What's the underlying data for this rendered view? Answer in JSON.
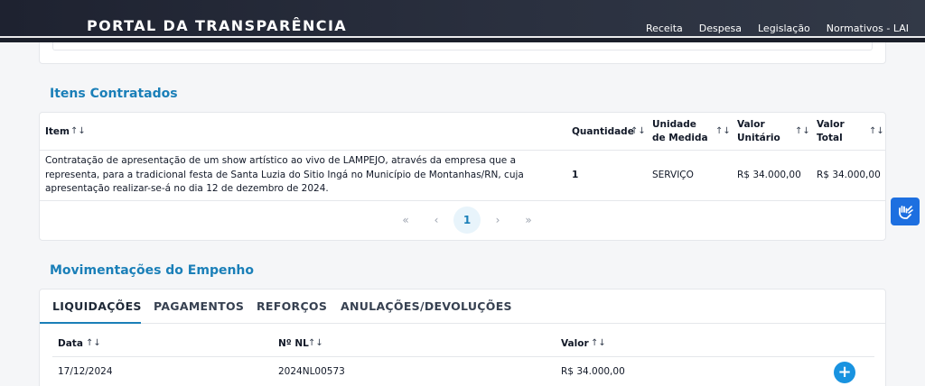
{
  "header": {
    "brand": "PORTAL DA TRANSPARÊNCIA",
    "nav": [
      "Receita",
      "Despesa",
      "Legislação",
      "Normativos - LAI"
    ]
  },
  "itens": {
    "title": "Itens Contratados",
    "columns": {
      "item": "Item",
      "quantidade": "Quantidade",
      "unidade": "Unidade de Medida",
      "valor_unitario": "Valor Unitário",
      "valor_total": "Valor Total"
    },
    "rows": [
      {
        "item": "Contratação de apresentação de um show artístico ao vivo de LAMPEJO, através da empresa que a representa, para a tradicional festa de Santa Luzia do Sitio Ingá no Município de Montanhas/RN, cuja apresentação realizar-se-á no dia 12 de dezembro de 2024.",
        "quantidade": "1",
        "unidade": "SERVIÇO",
        "valor_unitario": "R$ 34.000,00",
        "valor_total": "R$ 34.000,00"
      }
    ],
    "pagination": {
      "first": "«",
      "prev": "‹",
      "current": "1",
      "next": "›",
      "last": "»"
    }
  },
  "movimentacoes": {
    "title": "Movimentações do Empenho",
    "tabs": [
      "LIQUIDAÇÕES",
      "PAGAMENTOS",
      "REFORÇOS",
      "ANULAÇÕES/DEVOLUÇÕES"
    ],
    "active_tab": "LIQUIDAÇÕES",
    "columns": {
      "data": "Data",
      "nl": "Nº NL",
      "valor": "Valor"
    },
    "rows": [
      {
        "data": "17/12/2024",
        "nl": "2024NL00573",
        "valor": "R$ 34.000,00"
      }
    ]
  },
  "icons": {
    "sort": "sort-icon",
    "accessibility": "sign-language-icon",
    "expand": "plus-icon"
  },
  "colors": {
    "accent": "#1a7fb8",
    "header_bg": "#262b38",
    "a11y_button": "#1d6fe0",
    "plus_button": "#1993e0"
  }
}
